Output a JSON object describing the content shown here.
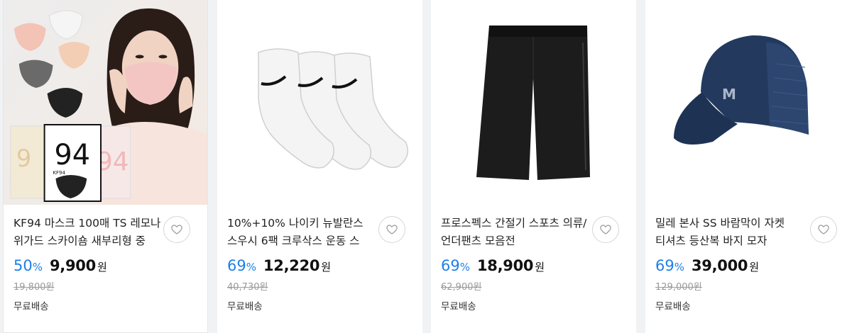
{
  "products": [
    {
      "title": "KF94 마스크 100매 TS 레모나 위가드 스카이숌 새부리형 중",
      "discount_rate": "50",
      "rate_unit": "%",
      "price": "9,900",
      "currency": "원",
      "original_price": "19,800원",
      "shipping": "무료배송",
      "image": {
        "box_front_text": "94",
        "box_side_text": "94",
        "box_label": "KF94"
      }
    },
    {
      "title": "10%+10% 나이키 뉴발란스 스우시 6팩 크루삭스 운동 스",
      "discount_rate": "69",
      "rate_unit": "%",
      "price": "12,220",
      "currency": "원",
      "original_price": "40,730원",
      "shipping": "무료배송"
    },
    {
      "title": "프로스펙스 간절기 스포츠 의류/언더팬츠 모음전",
      "discount_rate": "69",
      "rate_unit": "%",
      "price": "18,900",
      "currency": "원",
      "original_price": "62,900원",
      "shipping": "무료배송"
    },
    {
      "title": "밀레 본사 SS 바람막이 자켓 티셔츠 등산복 바지 모자",
      "discount_rate": "69",
      "rate_unit": "%",
      "price": "39,000",
      "currency": "원",
      "original_price": "129,000원",
      "shipping": "무료배송"
    }
  ],
  "icons": {
    "wishlist": "heart-outline-icon"
  },
  "colors": {
    "discount": "#1e7fe8",
    "background": "#f1f2f4"
  }
}
